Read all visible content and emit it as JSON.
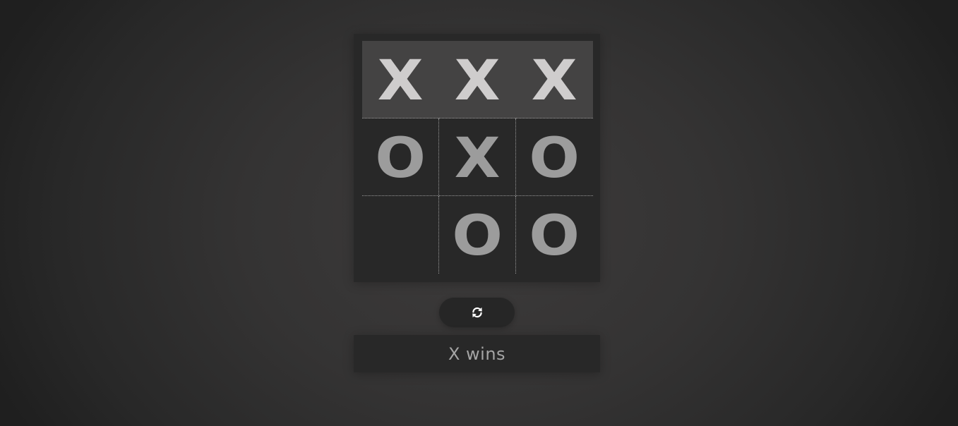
{
  "board": {
    "cells": [
      {
        "mark": "X",
        "winning": true
      },
      {
        "mark": "X",
        "winning": true
      },
      {
        "mark": "X",
        "winning": true
      },
      {
        "mark": "O",
        "winning": false
      },
      {
        "mark": "X",
        "winning": false
      },
      {
        "mark": "O",
        "winning": false
      },
      {
        "mark": "",
        "winning": false
      },
      {
        "mark": "O",
        "winning": false
      },
      {
        "mark": "O",
        "winning": false
      }
    ]
  },
  "reset_button": {
    "icon": "refresh-icon"
  },
  "status": {
    "text": "X wins"
  },
  "colors": {
    "background": "#343333",
    "board": "#282828",
    "winning_cell": "#444343",
    "winning_mark": "#cfcdcd",
    "mark": "#9c9c9c",
    "status_text": "#a5a5a5",
    "grid_line": "#9a9a9a"
  }
}
